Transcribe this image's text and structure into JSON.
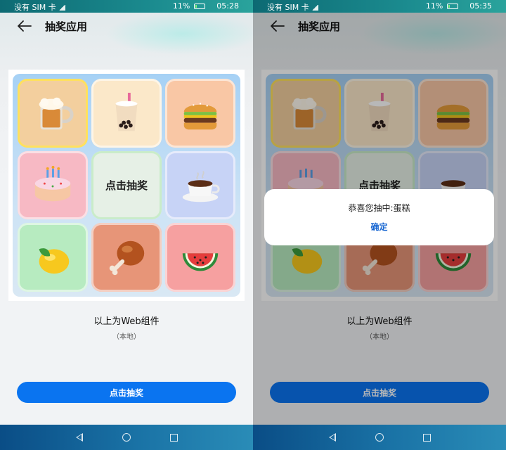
{
  "screens": [
    {
      "status": {
        "carrier": "没有 SIM 卡",
        "battery": "11%",
        "time": "05:28"
      },
      "header": {
        "title": "抽奖应用"
      },
      "grid": {
        "center_label": "点击抽奖"
      },
      "caption": "以上为Web组件",
      "subcaption": "（本地）",
      "button_label": "点击抽奖"
    },
    {
      "status": {
        "carrier": "没有 SIM 卡",
        "battery": "11%",
        "time": "05:35"
      },
      "header": {
        "title": "抽奖应用"
      },
      "grid": {
        "center_label": "点击抽奖"
      },
      "caption": "以上为Web组件",
      "subcaption": "（本地）",
      "button_label": "点击抽奖",
      "dialog": {
        "message": "恭喜您抽中:蛋糕",
        "confirm": "确定"
      }
    }
  ],
  "prizes": [
    "beer-icon",
    "bubble-tea-icon",
    "burger-icon",
    "cake-icon",
    "draw",
    "coffee-icon",
    "lemon-icon",
    "chicken-leg-icon",
    "watermelon-icon"
  ],
  "colors": {
    "accent": "#0a74f0",
    "dialog_link": "#1967d2"
  }
}
